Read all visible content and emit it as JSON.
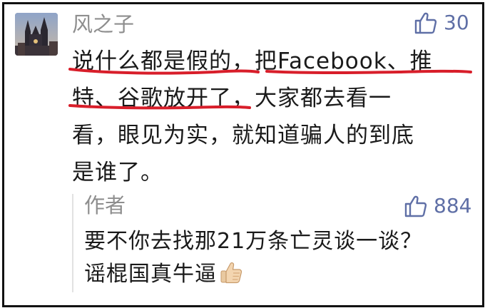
{
  "comment": {
    "username": "风之子",
    "like_count": "30",
    "lines": [
      "说什么都是假的，把Facebook、推",
      "特、谷歌放开了，大家都去看一",
      "看，眼见为实，就知道骗人的到底",
      "是谁了。"
    ]
  },
  "reply": {
    "author": "作者",
    "like_count": "884",
    "lines": [
      "要不你去找那21万条亡灵谈一谈？",
      "谣棍国真牛逼"
    ],
    "emoji": "thumbs-up-emoji"
  },
  "icons": {
    "like": "thumbs-up-outline-icon",
    "avatar": "cathedral-avatar"
  },
  "colors": {
    "like_blue": "#5f6fa6",
    "meta_gray": "#8e8e8e",
    "text": "#1a1a1a",
    "underline_red": "#d81e2a"
  }
}
